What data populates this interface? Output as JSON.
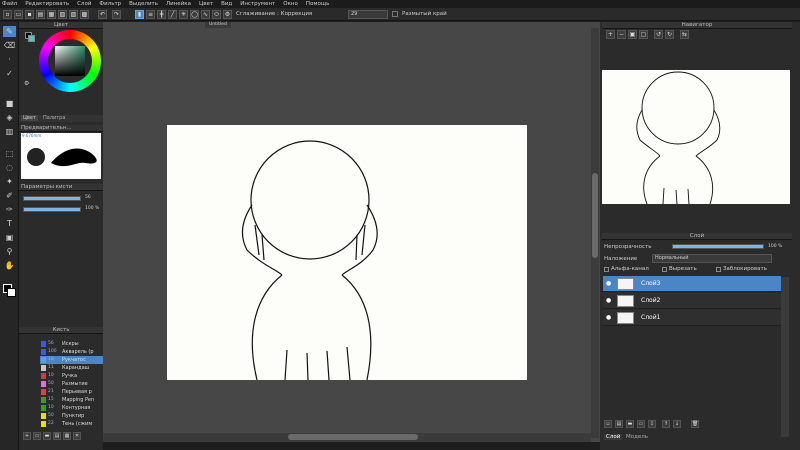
{
  "menu": [
    "Файл",
    "Редактировать",
    "Слой",
    "Фильтр",
    "Выделить",
    "Линейка",
    "Цвет",
    "Вид",
    "Инструмент",
    "Окно",
    "Помощь"
  ],
  "toolbar": {
    "correction_label": "Сглаживание : Коррекция",
    "correction_value": "29",
    "blur_label": "Размытый край"
  },
  "document": {
    "tab": "Untitled"
  },
  "left": {
    "color_title": "Цвет",
    "tabs": [
      "Цвет",
      "Палитра"
    ],
    "preview_title": "Предварительн...",
    "preview_size": "9,676mm",
    "brush_params_title": "Параметры кисти",
    "size_value": "56",
    "opacity_value": "100 %",
    "brush_title": "Кисть",
    "brushes": [
      {
        "size": "56",
        "name": "Искры",
        "color": "#3a5bd9"
      },
      {
        "size": "100",
        "name": "Акварель (р",
        "color": "#3a5bd9"
      },
      {
        "size": "18",
        "name": "Рукчатос",
        "color": "#5aa0e8"
      },
      {
        "size": "11",
        "name": "Карандаш",
        "color": "#c8c8c8"
      },
      {
        "size": "10",
        "name": "Ручка",
        "color": "#c84040"
      },
      {
        "size": "50",
        "name": "Размытие",
        "color": "#e070e0"
      },
      {
        "size": "21",
        "name": "Перьевая р",
        "color": "#e04040"
      },
      {
        "size": "15",
        "name": "Mapping Pen",
        "color": "#30a030"
      },
      {
        "size": "10",
        "name": "Контурная",
        "color": "#30a030"
      },
      {
        "size": "50",
        "name": "Пунктир",
        "color": "#e8e000"
      },
      {
        "size": "22",
        "name": "Тень (сжим",
        "color": "#e8e000"
      }
    ]
  },
  "right": {
    "navigator_title": "Навигатор",
    "layer_title": "Слой",
    "opacity_label": "Непрозрачность",
    "opacity_value": "100 %",
    "blend_label": "Наложение",
    "blend_value": "Нормальный",
    "alpha_label": "Альфа-канал",
    "clip_label": "Вырезать",
    "lock_label": "Заблокировать",
    "layers": [
      {
        "name": "Слой3",
        "selected": true
      },
      {
        "name": "Слой2",
        "selected": false
      },
      {
        "name": "Слой1",
        "selected": false
      }
    ],
    "bottom_tabs": [
      "Слой",
      "Модель"
    ]
  },
  "colors": {
    "accent": "#4a86c5",
    "panel_bg": "#2b2b2b",
    "canvas_area": "#474747",
    "paper": "#fdfdfa"
  }
}
